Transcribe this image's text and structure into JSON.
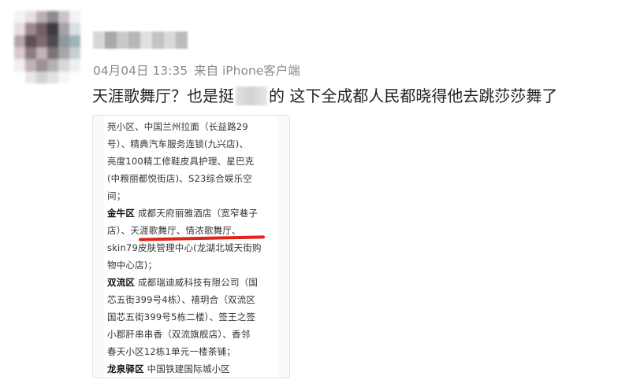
{
  "post": {
    "meta": {
      "date": "04月04日",
      "time": "13:35",
      "source": "来自 iPhone客户端"
    },
    "content": {
      "part1": "天涯歌舞厅？也是挺",
      "part2": "的 这下全成都人民都晓得他去跳莎莎舞了"
    },
    "image_text": {
      "l1": "苑小区、中国兰州拉面（长益路29",
      "l2": "号）、精典汽车服务连锁(九兴店)、",
      "l3": "亮度100精工修鞋皮具护理、星巴克",
      "l4": "(中粮丽都悦街店)、S23综合娱乐空",
      "l5": "间；",
      "l6_district": "金牛区",
      "l6_text": " 成都天府丽雅酒店（宽窄巷子",
      "l7": "店）、天涯歌舞厅、情浓歌舞厅、",
      "l8": "skin79皮肤管理中心(龙湖北城天街购",
      "l9": "物中心店)；",
      "l10_district": "双流区",
      "l10_text": " 成都瑞迪威科技有限公司（国",
      "l11": "芯五街399号4栋）、禧玥合（双流区",
      "l12": "国芯五街399号5栋二楼）、签王之签",
      "l13": "小郡肝串串香（双流旗舰店）、香邻",
      "l14": "春天小区12栋1单元一楼茶铺；",
      "l15_district": "龙泉驿区",
      "l15_text": " 中国铁建国际城小区"
    },
    "colors": {
      "meta_gray": "#8a8a8a",
      "text": "#222222",
      "highlight_red": "#e0241b"
    }
  }
}
